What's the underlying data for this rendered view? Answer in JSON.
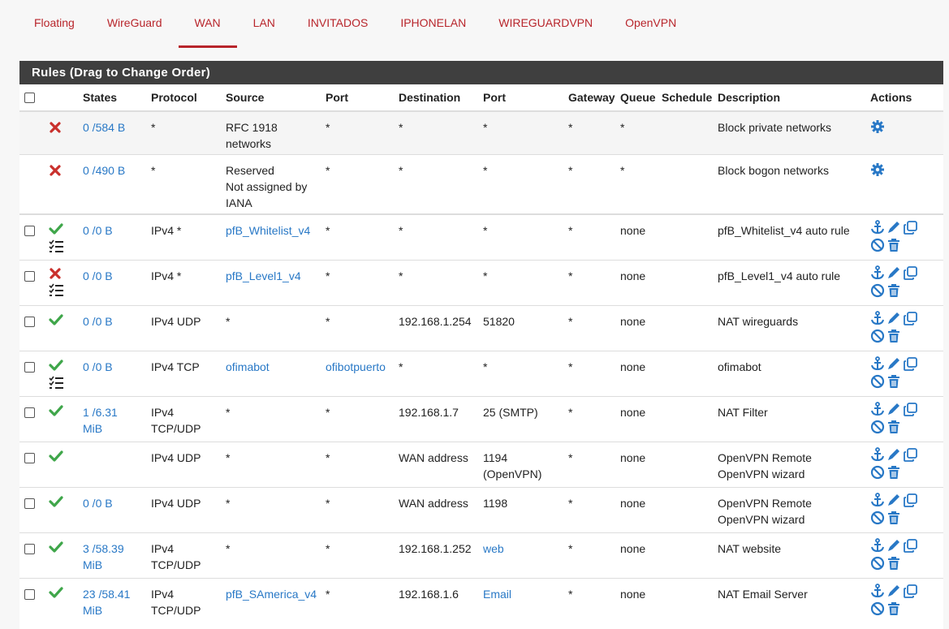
{
  "tabs": [
    {
      "label": "Floating",
      "active": false
    },
    {
      "label": "WireGuard",
      "active": false
    },
    {
      "label": "WAN",
      "active": true
    },
    {
      "label": "LAN",
      "active": false
    },
    {
      "label": "INVITADOS",
      "active": false
    },
    {
      "label": "IPHONELAN",
      "active": false
    },
    {
      "label": "WIREGUARDVPN",
      "active": false
    },
    {
      "label": "OpenVPN",
      "active": false
    }
  ],
  "panel": {
    "title": "Rules (Drag to Change Order)"
  },
  "columns": [
    "States",
    "Protocol",
    "Source",
    "Port",
    "Destination",
    "Port",
    "Gateway",
    "Queue",
    "Schedule",
    "Description",
    "Actions"
  ],
  "colors": {
    "accent": "#b8252b",
    "link": "#2878c6",
    "pass": "#3fa64a",
    "block": "#c9302c",
    "header_bg": "#3f3f3f"
  },
  "system_rules": [
    {
      "status": "block",
      "states": "0 /584 B",
      "protocol": "*",
      "source_l1": "RFC 1918",
      "source_l2": "networks",
      "source_l3": "",
      "port": "*",
      "destination": "*",
      "dport": "*",
      "gateway": "*",
      "queue": "*",
      "description": "Block private networks",
      "action_icon": "gear-icon"
    },
    {
      "status": "block",
      "states": "0 /490 B",
      "protocol": "*",
      "source_l1": "Reserved",
      "source_l2": "Not assigned by",
      "source_l3": "IANA",
      "port": "*",
      "destination": "*",
      "dport": "*",
      "gateway": "*",
      "queue": "*",
      "description": "Block bogon networks",
      "action_icon": "gear-icon"
    }
  ],
  "rules": [
    {
      "status": "pass",
      "list_icon": true,
      "states_l1": "0 /0 B",
      "states_l2": "",
      "protocol_l1": "IPv4 *",
      "protocol_l2": "",
      "source": "pfB_Whitelist_v4",
      "source_link": true,
      "port": "*",
      "port_link": false,
      "destination": "*",
      "dport_l1": "*",
      "dport_l2": "",
      "dport_link": false,
      "gateway": "*",
      "queue": "none",
      "desc_l1": "pfB_Whitelist_v4 auto rule",
      "desc_l2": ""
    },
    {
      "status": "block",
      "list_icon": true,
      "states_l1": "0 /0 B",
      "states_l2": "",
      "protocol_l1": "IPv4 *",
      "protocol_l2": "",
      "source": "pfB_Level1_v4",
      "source_link": true,
      "port": "*",
      "port_link": false,
      "destination": "*",
      "dport_l1": "*",
      "dport_l2": "",
      "dport_link": false,
      "gateway": "*",
      "queue": "none",
      "desc_l1": "pfB_Level1_v4 auto rule",
      "desc_l2": ""
    },
    {
      "status": "pass",
      "list_icon": false,
      "states_l1": "0 /0 B",
      "states_l2": "",
      "protocol_l1": "IPv4 UDP",
      "protocol_l2": "",
      "source": "*",
      "source_link": false,
      "port": "*",
      "port_link": false,
      "destination": "192.168.1.254",
      "dport_l1": "51820",
      "dport_l2": "",
      "dport_link": false,
      "gateway": "*",
      "queue": "none",
      "desc_l1": "NAT wireguards",
      "desc_l2": ""
    },
    {
      "status": "pass",
      "list_icon": true,
      "states_l1": "0 /0 B",
      "states_l2": "",
      "protocol_l1": "IPv4 TCP",
      "protocol_l2": "",
      "source": "ofimabot",
      "source_link": true,
      "port": "ofibotpuerto",
      "port_link": true,
      "destination": "*",
      "dport_l1": "*",
      "dport_l2": "",
      "dport_link": false,
      "gateway": "*",
      "queue": "none",
      "desc_l1": "ofimabot",
      "desc_l2": ""
    },
    {
      "status": "pass",
      "list_icon": false,
      "states_l1": "1 /6.31",
      "states_l2": "MiB",
      "protocol_l1": "IPv4",
      "protocol_l2": "TCP/UDP",
      "source": "*",
      "source_link": false,
      "port": "*",
      "port_link": false,
      "destination": "192.168.1.7",
      "dport_l1": "25 (SMTP)",
      "dport_l2": "",
      "dport_link": false,
      "gateway": "*",
      "queue": "none",
      "desc_l1": "NAT Filter",
      "desc_l2": ""
    },
    {
      "status": "pass",
      "list_icon": false,
      "states_l1": "",
      "states_l2": "",
      "protocol_l1": "IPv4 UDP",
      "protocol_l2": "",
      "source": "*",
      "source_link": false,
      "port": "*",
      "port_link": false,
      "destination": "WAN address",
      "dport_l1": "1194",
      "dport_l2": "(OpenVPN)",
      "dport_link": false,
      "gateway": "*",
      "queue": "none",
      "desc_l1": "OpenVPN Remote",
      "desc_l2": "OpenVPN wizard"
    },
    {
      "status": "pass",
      "list_icon": false,
      "states_l1": "0 /0 B",
      "states_l2": "",
      "protocol_l1": "IPv4 UDP",
      "protocol_l2": "",
      "source": "*",
      "source_link": false,
      "port": "*",
      "port_link": false,
      "destination": "WAN address",
      "dport_l1": "1198",
      "dport_l2": "",
      "dport_link": false,
      "gateway": "*",
      "queue": "none",
      "desc_l1": "OpenVPN Remote",
      "desc_l2": "OpenVPN wizard"
    },
    {
      "status": "pass",
      "list_icon": false,
      "states_l1": "3 /58.39",
      "states_l2": "MiB",
      "protocol_l1": "IPv4",
      "protocol_l2": "TCP/UDP",
      "source": "*",
      "source_link": false,
      "port": "*",
      "port_link": false,
      "destination": "192.168.1.252",
      "dport_l1": "web",
      "dport_l2": "",
      "dport_link": true,
      "gateway": "*",
      "queue": "none",
      "desc_l1": "NAT website",
      "desc_l2": ""
    },
    {
      "status": "pass",
      "list_icon": false,
      "states_l1": "23 /58.41",
      "states_l2": "MiB",
      "protocol_l1": "IPv4",
      "protocol_l2": "TCP/UDP",
      "source": "pfB_SAmerica_v4",
      "source_link": true,
      "port": "*",
      "port_link": false,
      "destination": "192.168.1.6",
      "dport_l1": "Email",
      "dport_l2": "",
      "dport_link": true,
      "gateway": "*",
      "queue": "none",
      "desc_l1": "NAT Email Server",
      "desc_l2": ""
    }
  ]
}
